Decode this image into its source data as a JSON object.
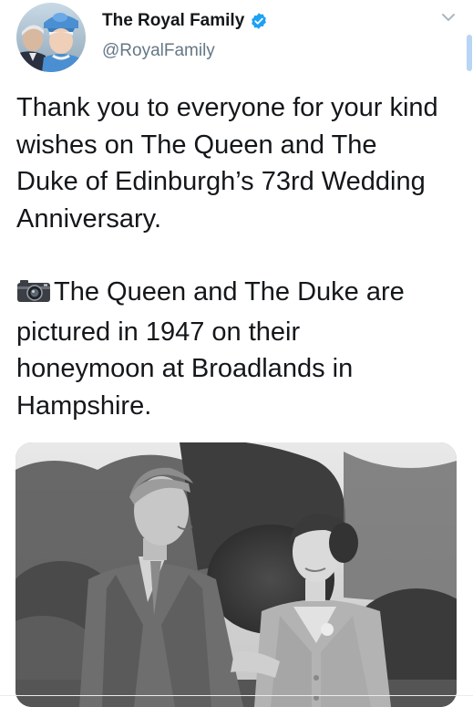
{
  "author": {
    "display_name": "The Royal Family",
    "handle": "@RoyalFamily",
    "verified": true,
    "verified_color": "#1da1f2"
  },
  "menu": {
    "icon": "chevron-down-icon"
  },
  "tweet": {
    "paragraph1": "Thank you to everyone for your kind wishes on The Queen and The Duke of Edinburgh’s 73rd Wedding Anniversary.",
    "paragraph2_emoji": "camera-icon",
    "paragraph2": "The Queen and The Duke are pictured in 1947 on their honeymoon at Broadlands in Hampshire."
  },
  "media": {
    "type": "photo",
    "style": "black-and-white"
  },
  "colors": {
    "text": "#14171a",
    "secondary_text": "#657786",
    "accent": "#1da1f2"
  }
}
